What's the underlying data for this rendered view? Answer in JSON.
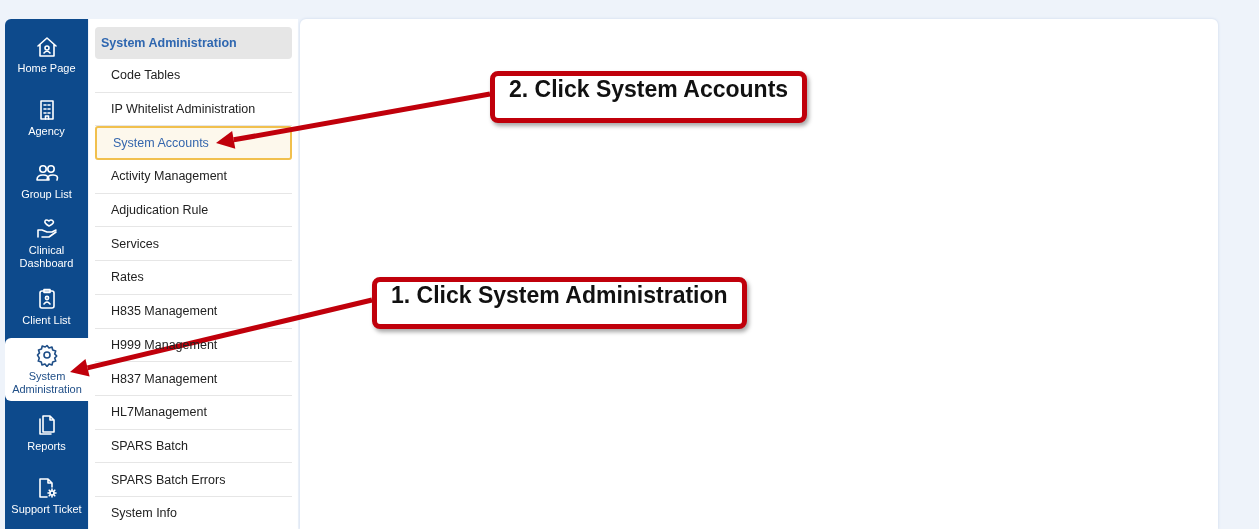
{
  "nav": {
    "items": [
      {
        "label": "Home Page",
        "selected": false
      },
      {
        "label": "Agency",
        "selected": false
      },
      {
        "label": "Group List",
        "selected": false
      },
      {
        "label": "Clinical Dashboard",
        "selected": false
      },
      {
        "label": "Client List",
        "selected": false
      },
      {
        "label": "System Administration",
        "selected": true
      },
      {
        "label": "Reports",
        "selected": false
      },
      {
        "label": "Support Ticket",
        "selected": false
      }
    ]
  },
  "submenu": {
    "title": "System Administration",
    "items": [
      {
        "label": "Code Tables",
        "selected": false
      },
      {
        "label": "IP Whitelist Administration",
        "selected": false
      },
      {
        "label": "System Accounts",
        "selected": true
      },
      {
        "label": "Activity Management",
        "selected": false
      },
      {
        "label": "Adjudication Rule",
        "selected": false
      },
      {
        "label": "Services",
        "selected": false
      },
      {
        "label": "Rates",
        "selected": false
      },
      {
        "label": "H835 Management",
        "selected": false
      },
      {
        "label": "H999 Management",
        "selected": false
      },
      {
        "label": "H837 Management",
        "selected": false
      },
      {
        "label": "HL7Management",
        "selected": false
      },
      {
        "label": "SPARS Batch",
        "selected": false
      },
      {
        "label": "SPARS Batch Errors",
        "selected": false
      },
      {
        "label": "System Info",
        "selected": false
      }
    ]
  },
  "annotations": [
    {
      "text": "2. Click System Accounts"
    },
    {
      "text": "1. Click System Administration"
    }
  ]
}
